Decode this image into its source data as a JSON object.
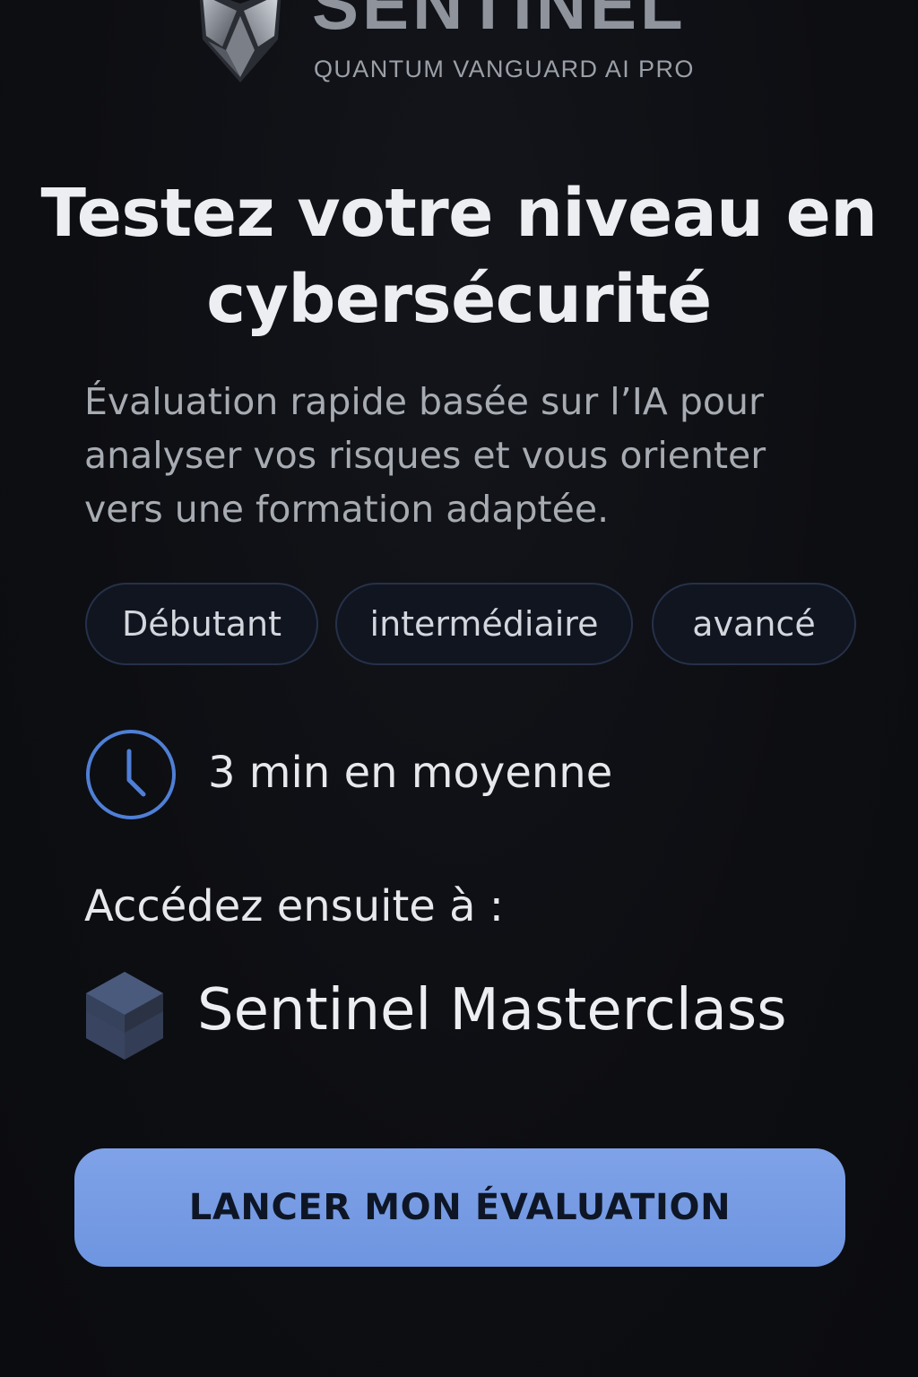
{
  "brand": {
    "name": "SENTINEL",
    "tagline": "QUANTUM VANGUARD AI PRO",
    "logo_icon": "shield-logo-icon"
  },
  "hero": {
    "title": "Testez votre niveau en cybersécurité",
    "subtitle": "Évaluation rapide basée sur l’IA pour analyser vos risques et vous orienter vers une formation adaptée."
  },
  "levels": [
    {
      "label": "Débutant"
    },
    {
      "label": "intermédiaire"
    },
    {
      "label": "avancé"
    }
  ],
  "duration": {
    "icon": "clock-icon",
    "text": "3 min en moyenne",
    "accent_color": "#4f7fd6"
  },
  "access": {
    "label": "Accédez ensuite à :",
    "product_icon": "cube-icon",
    "product_name": "Sentinel Masterclass"
  },
  "cta": {
    "label": "LANCER MON ÉVALUATION",
    "color": "#769be4"
  }
}
